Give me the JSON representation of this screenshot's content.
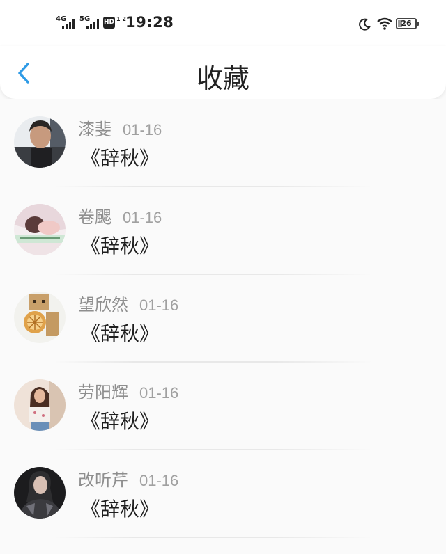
{
  "status_bar": {
    "signal1_label": "4G",
    "signal2_label": "5G",
    "hd_label": "HD",
    "hd_sub": "1 2",
    "time": "19:28",
    "battery": "26",
    "icons": [
      "moon-icon",
      "wifi-icon",
      "battery-icon"
    ]
  },
  "nav": {
    "title": "收藏",
    "back_icon": "chevron-left-icon",
    "accent_color": "#2f9be6"
  },
  "favorites": [
    {
      "name": "漆斐",
      "date": "01-16",
      "work": "《辞秋》"
    },
    {
      "name": "卷颸",
      "date": "01-16",
      "work": "《辞秋》"
    },
    {
      "name": "望欣然",
      "date": "01-16",
      "work": "《辞秋》"
    },
    {
      "name": "劳阳辉",
      "date": "01-16",
      "work": "《辞秋》"
    },
    {
      "name": "改听芹",
      "date": "01-16",
      "work": "《辞秋》"
    }
  ]
}
